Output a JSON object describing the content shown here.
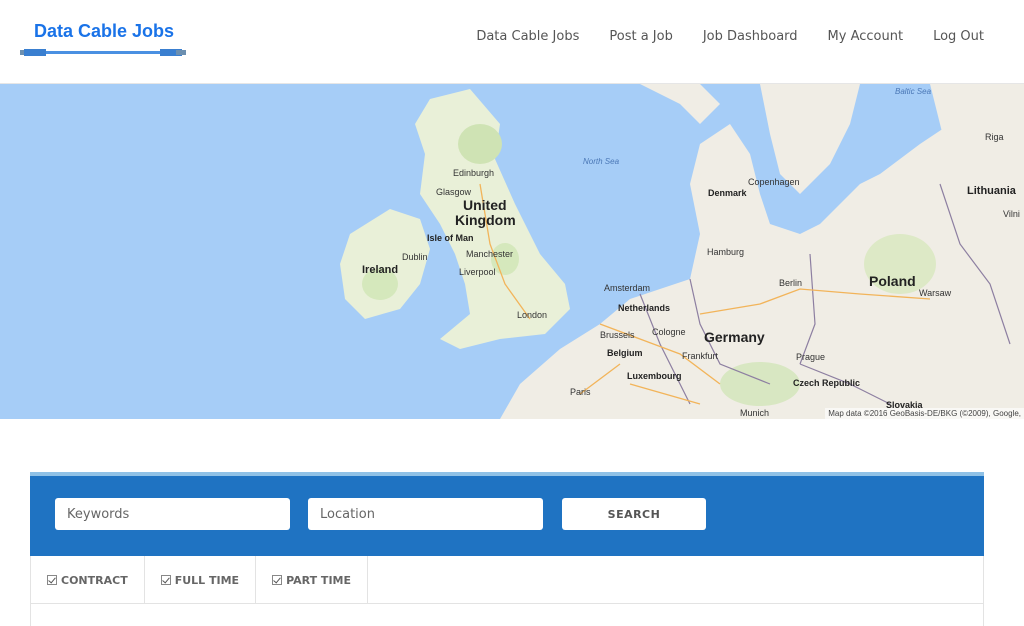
{
  "header": {
    "logo_text": "Data Cable Jobs",
    "nav": [
      {
        "label": "Data Cable Jobs"
      },
      {
        "label": "Post a Job"
      },
      {
        "label": "Job Dashboard"
      },
      {
        "label": "My Account"
      },
      {
        "label": "Log Out"
      }
    ]
  },
  "map": {
    "labels": {
      "baltic_sea": "Baltic Sea",
      "north_sea": "North Sea",
      "riga": "Riga",
      "lithuania": "Lithuania",
      "vilnius": "Vilni",
      "edinburgh": "Edinburgh",
      "glasgow": "Glasgow",
      "uk_1": "United",
      "uk_2": "Kingdom",
      "isle_of_man": "Isle of Man",
      "ireland": "Ireland",
      "dublin": "Dublin",
      "manchester": "Manchester",
      "liverpool": "Liverpool",
      "london": "London",
      "denmark": "Denmark",
      "copenhagen": "Copenhagen",
      "hamburg": "Hamburg",
      "berlin": "Berlin",
      "poland": "Poland",
      "warsaw": "Warsaw",
      "amsterdam": "Amsterdam",
      "netherlands": "Netherlands",
      "germany": "Germany",
      "brussels": "Brussels",
      "cologne": "Cologne",
      "belgium": "Belgium",
      "frankfurt": "Frankfurt",
      "luxembourg": "Luxembourg",
      "prague": "Prague",
      "czech": "Czech Republic",
      "paris": "Paris",
      "munich": "Munich",
      "slovakia": "Slovakia"
    },
    "attribution": "Map data ©2016 GeoBasis-DE/BKG (©2009), Google,"
  },
  "search": {
    "keywords_placeholder": "Keywords",
    "location_placeholder": "Location",
    "button_label": "SEARCH"
  },
  "filters": [
    {
      "label": "CONTRACT",
      "checked": true
    },
    {
      "label": "FULL TIME",
      "checked": true
    },
    {
      "label": "PART TIME",
      "checked": true
    }
  ],
  "colors": {
    "brand_blue": "#1a73e8",
    "search_panel": "#1f73c2",
    "sea": "#a6cdf7",
    "land": "#f0ede5"
  }
}
